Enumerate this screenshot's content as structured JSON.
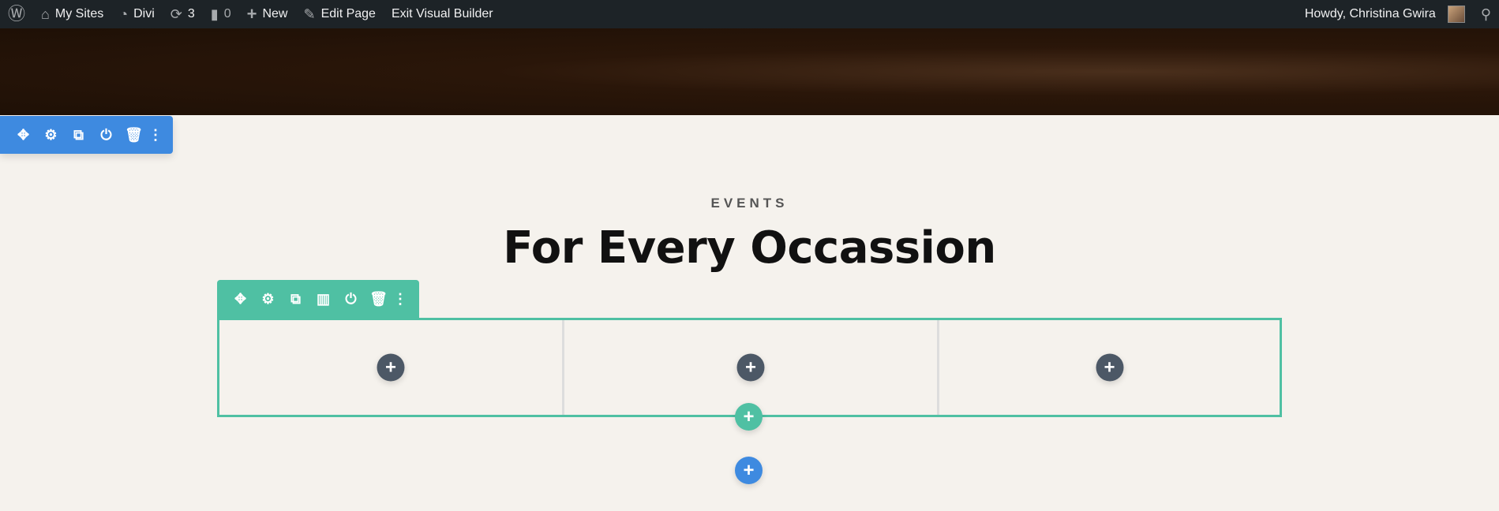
{
  "adminbar": {
    "wp_logo": "wordpress-icon",
    "my_sites": "My Sites",
    "divi": "Divi",
    "updates_count": "3",
    "comments_count": "0",
    "new": "New",
    "edit_page": "Edit Page",
    "exit_builder": "Exit Visual Builder",
    "howdy": "Howdy, Christina Gwira"
  },
  "section": {
    "eyebrow": "EVENTS",
    "title": "For Every Occassion"
  },
  "colors": {
    "section_accent": "#3e8ae0",
    "row_accent": "#4fc0a3",
    "module_add": "#4c5866",
    "adminbar": "#1d2327",
    "background": "#f5f2ed"
  },
  "section_toolbar": [
    "move-icon",
    "settings-icon",
    "duplicate-icon",
    "save-icon",
    "delete-icon",
    "more-icon"
  ],
  "row_toolbar": [
    "move-icon",
    "settings-icon",
    "duplicate-icon",
    "columns-icon",
    "save-icon",
    "delete-icon",
    "more-icon"
  ],
  "columns": 3
}
